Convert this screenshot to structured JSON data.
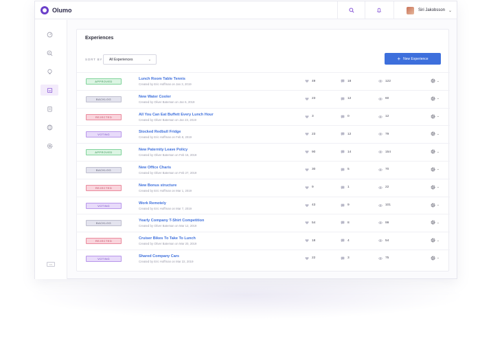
{
  "app": {
    "brand": "Olumo",
    "user_name": "Siri Jakobsson"
  },
  "icons": {
    "search": "search-icon",
    "notifications": "bell-icon",
    "settings": "gear-icon"
  },
  "sidebar": {
    "collapse_label": "<<",
    "items": [
      {
        "icon": "dashboard-icon",
        "active": false
      },
      {
        "icon": "search-chart-icon",
        "active": false
      },
      {
        "icon": "lightbulb-icon",
        "active": false
      },
      {
        "icon": "experiences-icon",
        "active": true
      },
      {
        "icon": "clipboard-icon",
        "active": false
      },
      {
        "icon": "globe-icon",
        "active": false
      },
      {
        "icon": "settings-icon",
        "active": false
      }
    ]
  },
  "main": {
    "title": "Experiences",
    "sort_label": "SORT BY",
    "sort_value": "All Experiences",
    "new_button": "New Experience",
    "rows": [
      {
        "status": "APPROVED",
        "kind": "approved",
        "title": "Lunch Room Table Tennis",
        "subtitle": "Created by Eric Hoffman on Jan 3, 2019",
        "likes": "49",
        "comments": "18",
        "views": "122"
      },
      {
        "status": "BACKLOG",
        "kind": "backlog",
        "title": "New Water Cooler",
        "subtitle": "Created by Oliver Bateman on Jan 6, 2019",
        "likes": "23",
        "comments": "12",
        "views": "60"
      },
      {
        "status": "REJECTED",
        "kind": "rejected",
        "title": "All You Can Eat Buffett Every Lunch Hour",
        "subtitle": "Created by Oliver Bateman on Jan 23, 2019",
        "likes": "3",
        "comments": "0",
        "views": "12"
      },
      {
        "status": "VOTING",
        "kind": "voting",
        "title": "Stocked Redbull Fridge",
        "subtitle": "Created by Eric Hoffman on Feb 8, 2019",
        "likes": "23",
        "comments": "12",
        "views": "79"
      },
      {
        "status": "APPROVED",
        "kind": "approved",
        "title": "New Paternity Leave Policy",
        "subtitle": "Created by Oliver Bateman on Feb 15, 2019",
        "likes": "90",
        "comments": "14",
        "views": "154"
      },
      {
        "status": "BACKLOG",
        "kind": "backlog",
        "title": "New Office Charis",
        "subtitle": "Created by Oliver Bateman on Feb 27, 2019",
        "likes": "30",
        "comments": "5",
        "views": "70"
      },
      {
        "status": "REJECTED",
        "kind": "rejected",
        "title": "New Bonus structure",
        "subtitle": "Created by Eric Hoffman on Mar 1, 2019",
        "likes": "9",
        "comments": "1",
        "views": "22"
      },
      {
        "status": "VOTING",
        "kind": "voting",
        "title": "Work Remotely",
        "subtitle": "Created by Eric Hoffman on Mar 7, 2019",
        "likes": "43",
        "comments": "9",
        "views": "101"
      },
      {
        "status": "BACKLOG",
        "kind": "backlog",
        "title": "Yearly Company T-Shirt Competition",
        "subtitle": "Created by Oliver Bateman on Mar 12, 2019",
        "likes": "54",
        "comments": "8",
        "views": "99"
      },
      {
        "status": "REJECTED",
        "kind": "rejected",
        "title": "Cruiser Bikes To Take To Lunch",
        "subtitle": "Created by Oliver Bateman on Mar 20, 2019",
        "likes": "18",
        "comments": "4",
        "views": "54"
      },
      {
        "status": "VOTING",
        "kind": "voting",
        "title": "Shared Company Cars",
        "subtitle": "Created by Eric Hoffman on Mar 22, 2019",
        "likes": "22",
        "comments": "3",
        "views": "75"
      }
    ]
  }
}
